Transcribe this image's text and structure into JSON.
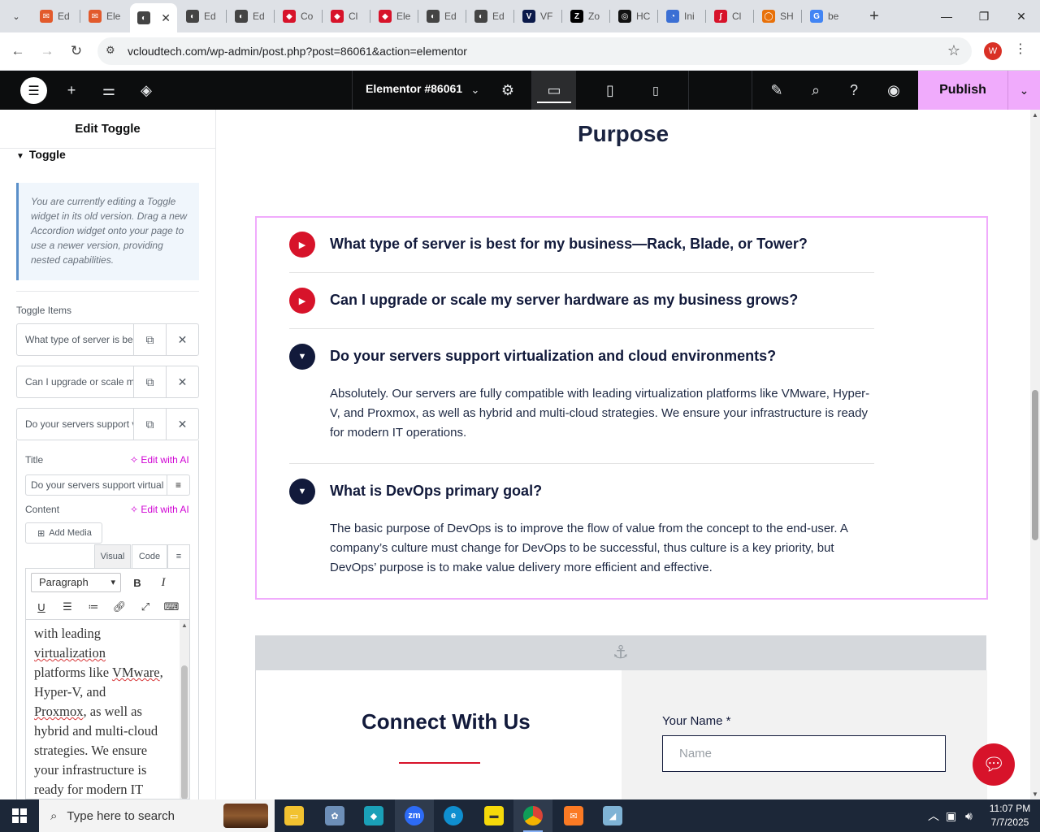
{
  "browser": {
    "tabs": [
      {
        "label": "Ed",
        "fav_color": "#e25a2c",
        "fav_glyph": "✉"
      },
      {
        "label": "Ele",
        "fav_color": "#e25a2c",
        "fav_glyph": "✉"
      },
      {
        "label": "",
        "fav_color": "#444",
        "fav_glyph": "◐",
        "active": true
      },
      {
        "label": "Ed",
        "fav_color": "#444",
        "fav_glyph": "◐"
      },
      {
        "label": "Ed",
        "fav_color": "#444",
        "fav_glyph": "◐"
      },
      {
        "label": "Co",
        "fav_color": "#d7132a",
        "fav_glyph": "◆"
      },
      {
        "label": "Cl",
        "fav_color": "#d7132a",
        "fav_glyph": "◆"
      },
      {
        "label": "Ele",
        "fav_color": "#d7132a",
        "fav_glyph": "◆"
      },
      {
        "label": "Ed",
        "fav_color": "#444",
        "fav_glyph": "◐"
      },
      {
        "label": "Ed",
        "fav_color": "#444",
        "fav_glyph": "◐"
      },
      {
        "label": "VF",
        "fav_color": "#0b1a4a",
        "fav_glyph": "V"
      },
      {
        "label": "Zo",
        "fav_color": "#000",
        "fav_glyph": "Z"
      },
      {
        "label": "HC",
        "fav_color": "#111",
        "fav_glyph": "◎"
      },
      {
        "label": "Ini",
        "fav_color": "#3b6fd4",
        "fav_glyph": "◔"
      },
      {
        "label": "Cl",
        "fav_color": "#d7132a",
        "fav_glyph": "∫"
      },
      {
        "label": "SH",
        "fav_color": "#e8710a",
        "fav_glyph": "◯"
      },
      {
        "label": "be",
        "fav_color": "#4285f4",
        "fav_glyph": "G"
      }
    ],
    "url": "vcloudtech.com/wp-admin/post.php?post=86061&action=elementor",
    "profile_initial": "W"
  },
  "elementor": {
    "document_title": "Elementor #86061",
    "publish_label": "Publish"
  },
  "panel": {
    "title": "Edit Toggle",
    "section": "Toggle",
    "notice": "You are currently editing a Toggle widget in its old version. Drag a new Accordion widget onto your page to use a newer version, providing nested capabilities.",
    "items_label": "Toggle Items",
    "items": [
      "What type of server is be",
      "Can I upgrade or scale m",
      "Do your servers support v"
    ],
    "title_label": "Title",
    "edit_ai": "Edit with AI",
    "title_value": "Do your servers support virtual",
    "content_label": "Content",
    "add_media": "Add Media",
    "tab_visual": "Visual",
    "tab_code": "Code",
    "format": "Paragraph",
    "editor_lines": [
      {
        "text": "with leading",
        "spell": false
      },
      {
        "text": "virtualization",
        "spell": true
      },
      {
        "text": "platforms like VMware,",
        "spell": "VMware"
      },
      {
        "text": "Hyper-V, and",
        "spell": false
      },
      {
        "text": "Proxmox, as well as",
        "spell": "Proxmox"
      },
      {
        "text": "hybrid and multi-cloud",
        "spell": false
      },
      {
        "text": "strategies. We ensure",
        "spell": false
      },
      {
        "text": "your infrastructure is",
        "spell": false
      },
      {
        "text": "ready for modern IT",
        "spell": false
      }
    ]
  },
  "canvas": {
    "heading": "Purpose",
    "faqs": [
      {
        "question": "What type of server is best for my business—Rack, Blade, or Tower?",
        "open": false
      },
      {
        "question": "Can I upgrade or scale my server hardware as my business grows?",
        "open": false
      },
      {
        "question": "Do your servers support virtualization and cloud environments?",
        "open": true,
        "answer": "Absolutely. Our servers are fully compatible with leading virtualization platforms like VMware, Hyper-V, and Proxmox, as well as hybrid and multi-cloud strategies. We ensure your infrastructure is ready for modern IT operations."
      },
      {
        "question": "What is DevOps primary goal?",
        "open": true,
        "answer": "The basic purpose of DevOps is to improve the flow of value from the concept to the end-user. A company’s culture must change for DevOps to be successful, thus culture is a key priority, but DevOps’ purpose is to make value delivery more efficient and effective."
      }
    ],
    "connect_title": "Connect With Us",
    "name_label": "Your Name *",
    "name_placeholder": "Name"
  },
  "taskbar": {
    "search_placeholder": "Type here to search",
    "time": "11:07 PM",
    "date": "7/7/2025"
  },
  "colors": {
    "accent_red": "#d7132a",
    "navy": "#121a3b",
    "publish_pink": "#f0abfc"
  }
}
